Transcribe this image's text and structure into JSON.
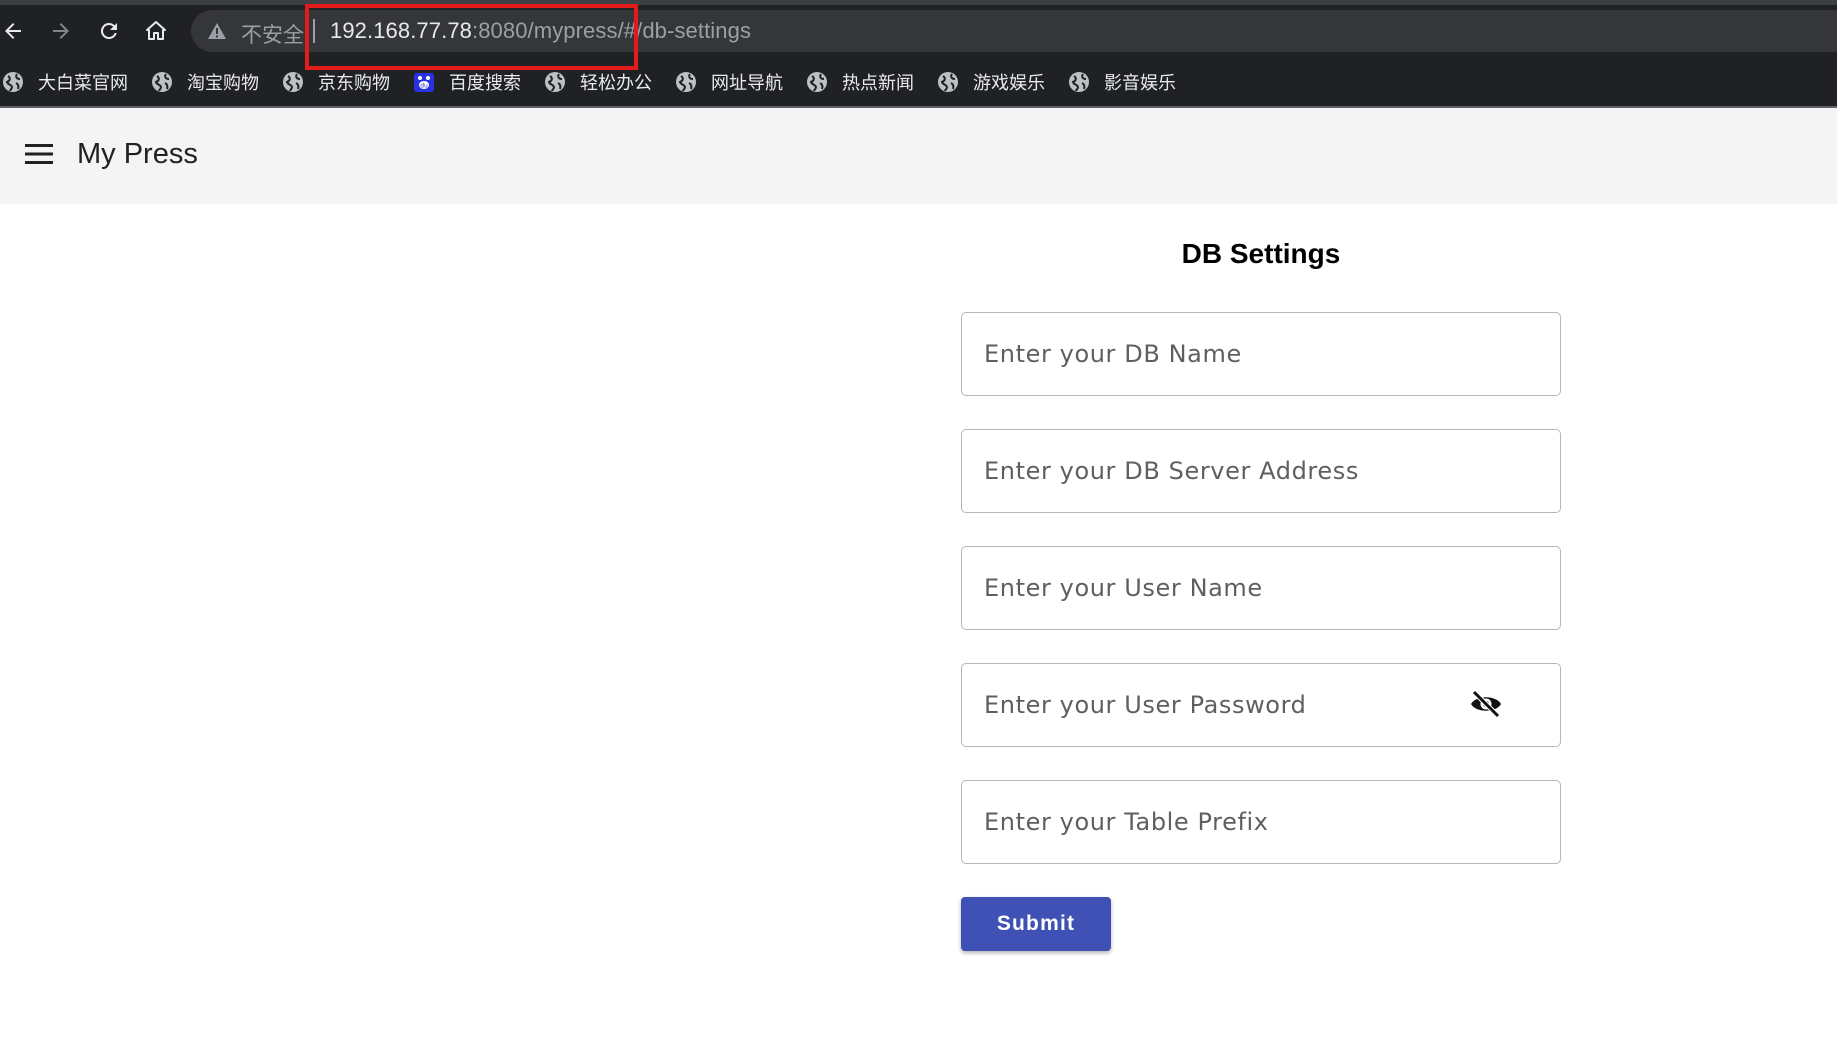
{
  "browser": {
    "address": {
      "security_label": "不安全",
      "host": "192.168.77.78",
      "path": ":8080/mypress/#/db-settings"
    },
    "bookmarks": [
      {
        "label": "大白菜官网",
        "icon": "globe-icon"
      },
      {
        "label": "淘宝购物",
        "icon": "globe-icon"
      },
      {
        "label": "京东购物",
        "icon": "globe-icon"
      },
      {
        "label": "百度搜索",
        "icon": "baidu-icon"
      },
      {
        "label": "轻松办公",
        "icon": "globe-icon"
      },
      {
        "label": "网址导航",
        "icon": "globe-icon"
      },
      {
        "label": "热点新闻",
        "icon": "globe-icon"
      },
      {
        "label": "游戏娱乐",
        "icon": "globe-icon"
      },
      {
        "label": "影音娱乐",
        "icon": "globe-icon"
      }
    ],
    "highlight_color": "#e31b1b"
  },
  "appbar": {
    "title": "My Press",
    "menu_icon": "hamburger-menu-icon"
  },
  "form": {
    "title": "DB Settings",
    "fields": {
      "db_name": {
        "placeholder": "Enter your DB Name",
        "value": ""
      },
      "db_server": {
        "placeholder": "Enter your DB Server Address",
        "value": ""
      },
      "user_name": {
        "placeholder": "Enter your User Name",
        "value": ""
      },
      "user_password": {
        "placeholder": "Enter your User Password",
        "value": "",
        "toggle_icon": "eye-off-icon"
      },
      "table_prefix": {
        "placeholder": "Enter your Table Prefix",
        "value": ""
      }
    },
    "submit_label": "Submit",
    "accent_color": "#3f51b5"
  }
}
